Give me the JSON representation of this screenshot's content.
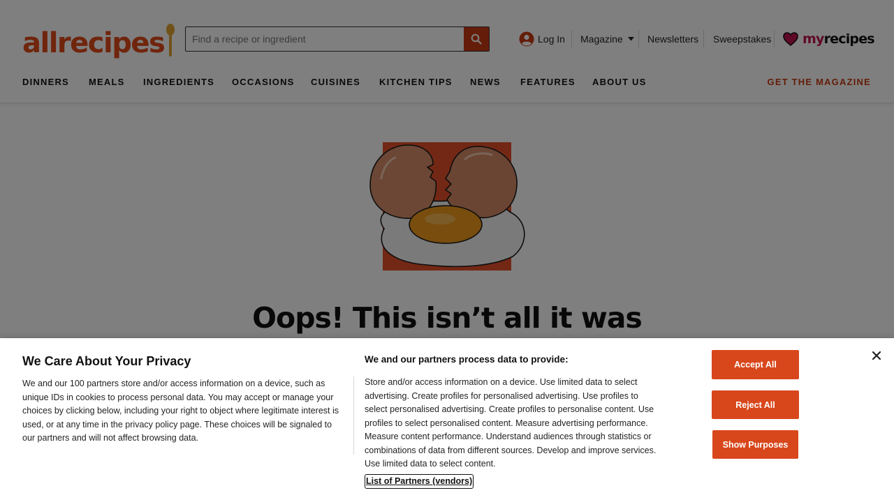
{
  "brand": {
    "logo_text": "allrecipes",
    "accent_color": "#e04a1a",
    "cta_color": "#c93b12"
  },
  "search": {
    "placeholder": "Find a recipe or ingredient",
    "button_icon": "search-icon"
  },
  "utility_nav": {
    "login_label": "Log In",
    "login_icon": "user-circle-icon",
    "magazine_label": "Magazine",
    "newsletters_label": "Newsletters",
    "sweepstakes_label": "Sweepstakes",
    "myrecipes_prefix": "my",
    "myrecipes_suffix": "recipes"
  },
  "main_nav": {
    "items": [
      {
        "label": "DINNERS"
      },
      {
        "label": "MEALS"
      },
      {
        "label": "INGREDIENTS"
      },
      {
        "label": "OCCASIONS"
      },
      {
        "label": "CUISINES"
      },
      {
        "label": "KITCHEN TIPS"
      },
      {
        "label": "NEWS"
      },
      {
        "label": "FEATURES"
      },
      {
        "label": "ABOUT US"
      }
    ],
    "cta_label": "GET THE MAGAZINE"
  },
  "main": {
    "error_title": "Oops! This isn’t all it was",
    "illustration": "cracked-egg-illustration"
  },
  "consent": {
    "title": "We Care About Your Privacy",
    "description": "We and our 100 partners store and/or access information on a device, such as unique IDs in cookies to process personal data. You may accept or manage your choices by clicking below, including your right to object where legitimate interest is used, or at any time in the privacy policy page. These choices will be signaled to our partners and will not affect browsing data.",
    "purposes_heading": "We and our partners process data to provide:",
    "purposes_text": "Store and/or access information on a device. Use limited data to select advertising. Create profiles for personalised advertising. Use profiles to select personalised advertising. Create profiles to personalise content. Use profiles to select personalised content. Measure advertising performance. Measure content performance. Understand audiences through statistics or combinations of data from different sources. Develop and improve services. Use limited data to select content.",
    "partners_link": "List of Partners (vendors)",
    "accept_label": "Accept All",
    "reject_label": "Reject All",
    "show_purposes_label": "Show Purposes",
    "button_color": "#d8471c",
    "close_icon": "close-icon"
  }
}
